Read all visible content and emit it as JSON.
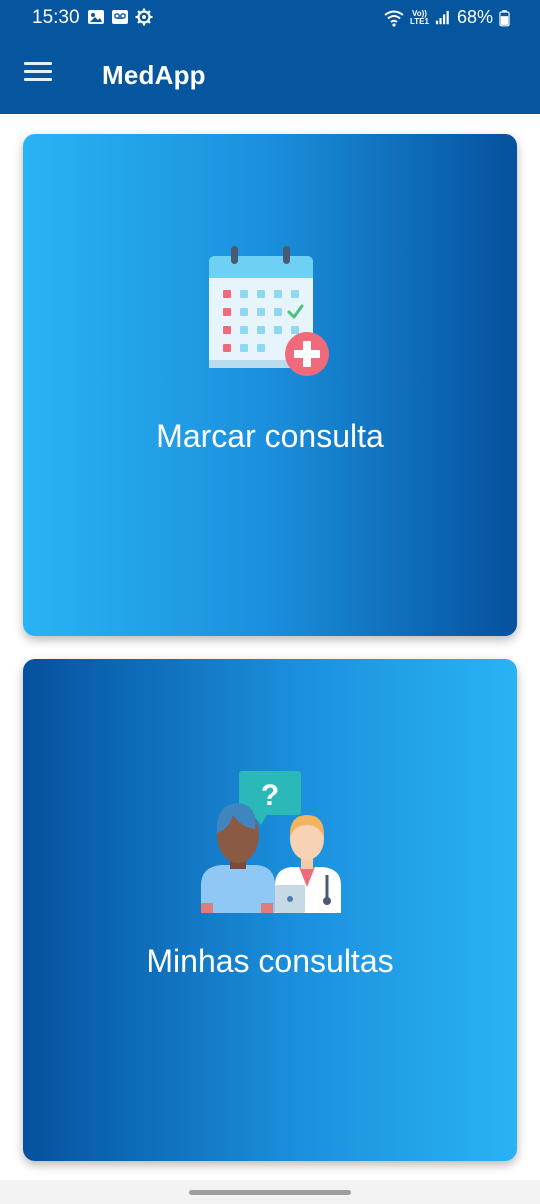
{
  "status_bar": {
    "time": "15:30",
    "left_icons": [
      "image-icon",
      "voicemail-icon",
      "settings-gear-icon"
    ],
    "network_label_top": "Vo))",
    "network_label_bottom": "LTE1",
    "battery": "68%"
  },
  "app_bar": {
    "title": "MedApp",
    "menu_icon": "hamburger-menu-icon"
  },
  "cards": [
    {
      "label": "Marcar consulta",
      "icon": "calendar-add-icon"
    },
    {
      "label": "Minhas consultas",
      "icon": "patient-doctor-question-icon"
    }
  ],
  "colors": {
    "primary": "#05569e",
    "card_light": "#29b3f5",
    "card_dark": "#05519d",
    "text_on_primary": "#ffffff"
  }
}
